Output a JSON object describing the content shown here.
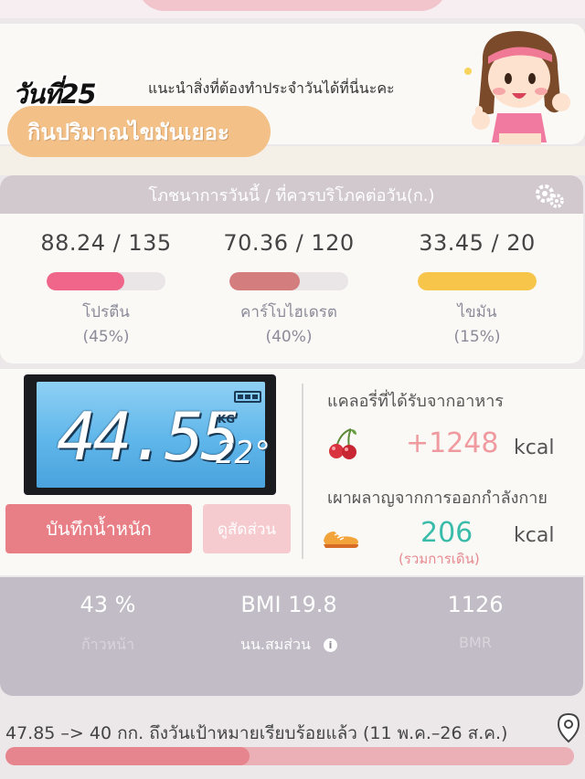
{
  "header": {
    "day_label": "วันที่25",
    "tip": "แนะนำสิ่งที่ต้องทำประจำวันได้ที่นี่นะคะ",
    "highlight": "กินปริมาณไขมันเยอะ"
  },
  "nutrition": {
    "title": "โภชนาการวันนี้ / ที่ควรบริโภคต่อวัน(ก.)",
    "macros": [
      {
        "value": "88.24 / 135",
        "name": "โปรตีน",
        "percent": "(45%)",
        "fill": 0.65,
        "color": "#f0668a"
      },
      {
        "value": "70.36 / 120",
        "name": "คาร์โบไฮเดรต",
        "percent": "(40%)",
        "fill": 0.59,
        "color": "#d47d7e"
      },
      {
        "value": "33.45 / 20",
        "name": "ไขมัน",
        "percent": "(15%)",
        "fill": 1.0,
        "color": "#f7c54a"
      }
    ]
  },
  "weight": {
    "scale_reading": "44.55",
    "scale_unit": "KG",
    "scale_temp": "22°",
    "record_button": "บันทึกน้ำหนัก",
    "ratio_button": "ดูสัดส่วน"
  },
  "calories": {
    "intake_label": "แคลอรี่ที่ได้รับจากอาหาร",
    "intake_value": "+1248",
    "intake_unit": "kcal",
    "intake_color": "#ef9a9f",
    "burn_label": "เผาผลาญจากการออกกำลังกาย",
    "burn_value": "206",
    "burn_unit": "kcal",
    "burn_color": "#3bbcaa",
    "burn_note": "(รวมการเดิน)"
  },
  "stats": {
    "progress_value": "43 %",
    "progress_label": "ก้าวหน้า",
    "bmi_value": "BMI 19.8",
    "bmi_label": "นน.สมส่วน",
    "bmr_value": "1126",
    "bmr_label": "BMR"
  },
  "goal": {
    "text": "47.85 –> 40 กก. ถึงวันเป้าหมายเรียบร้อยแล้ว (11 พ.ค.–26 ส.ค.)",
    "progress": 0.43
  }
}
